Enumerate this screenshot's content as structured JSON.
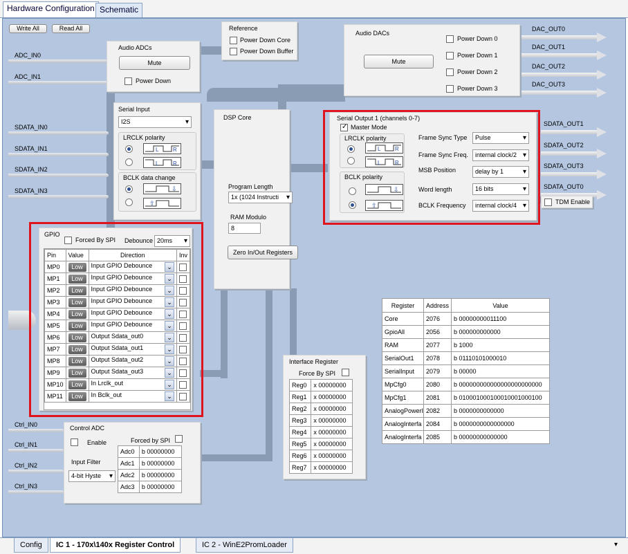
{
  "top_tabs": [
    "Hardware Configuration",
    "Schematic"
  ],
  "toolbar": {
    "write_all": "Write All",
    "read_all": "Read All"
  },
  "reference": {
    "title": "Reference",
    "power_down_core": "Power Down Core",
    "power_down_buffer": "Power Down Buffer"
  },
  "audio_adcs": {
    "title": "Audio ADCs",
    "mute": "Mute",
    "power_down": "Power Down"
  },
  "audio_dacs": {
    "title": "Audio DACs",
    "mute": "Mute",
    "pd0": "Power Down 0",
    "pd1": "Power Down 1",
    "pd2": "Power Down 2",
    "pd3": "Power Down 3"
  },
  "inputs": {
    "adc_in0": "ADC_IN0",
    "adc_in1": "ADC_IN1",
    "sdata_in0": "SDATA_IN0",
    "sdata_in1": "SDATA_IN1",
    "sdata_in2": "SDATA_IN2",
    "sdata_in3": "SDATA_IN3",
    "ctrl_in0": "Ctrl_IN0",
    "ctrl_in1": "Ctrl_IN1",
    "ctrl_in2": "Ctrl_IN2",
    "ctrl_in3": "Ctrl_IN3"
  },
  "outputs": {
    "dac0": "DAC_OUT0",
    "dac1": "DAC_OUT1",
    "dac2": "DAC_OUT2",
    "dac3": "DAC_OUT3",
    "sd1": "SDATA_OUT1",
    "sd2": "SDATA_OUT2",
    "sd3": "SDATA_OUT3",
    "sd0": "SDATA_OUT0",
    "tdm": "TDM Enable"
  },
  "serial_input": {
    "title": "Serial Input",
    "format": "I2S",
    "lrclk": "LRCLK polarity",
    "bclk": "BCLK data change"
  },
  "dsp": {
    "title": "DSP Core",
    "program_length_label": "Program Length",
    "program_length": "1x (1024 Instructi",
    "ram_modulo_label": "RAM Modulo",
    "ram_modulo": "8",
    "zero_btn": "Zero In/Out Registers"
  },
  "serial_output": {
    "title": "Serial Output 1 (channels 0-7)",
    "master": "Master Mode",
    "lrclk": "LRCLK polarity",
    "bclk": "BCLK polarity",
    "fields": [
      {
        "label": "Frame Sync Type",
        "value": "Pulse"
      },
      {
        "label": "Frame Sync Freq.",
        "value": "internal clock/2"
      },
      {
        "label": "MSB Position",
        "value": "delay by 1"
      },
      {
        "label": "Word length",
        "value": "16 bits"
      },
      {
        "label": "BCLK Frequency",
        "value": "internal clock/4"
      }
    ]
  },
  "gpio": {
    "title": "GPIO",
    "forced": "Forced By SPI",
    "debounce_label": "Debounce",
    "debounce": "20ms",
    "headers": [
      "Pin",
      "Value",
      "Direction",
      "Inv"
    ],
    "rows": [
      {
        "pin": "MP0",
        "value": "Low",
        "dir": "Input  GPIO Debounce"
      },
      {
        "pin": "MP1",
        "value": "Low",
        "dir": "Input  GPIO Debounce"
      },
      {
        "pin": "MP2",
        "value": "Low",
        "dir": "Input  GPIO Debounce"
      },
      {
        "pin": "MP3",
        "value": "Low",
        "dir": "Input  GPIO Debounce"
      },
      {
        "pin": "MP4",
        "value": "Low",
        "dir": "Input  GPIO Debounce"
      },
      {
        "pin": "MP5",
        "value": "Low",
        "dir": "Input  GPIO Debounce"
      },
      {
        "pin": "MP6",
        "value": "Low",
        "dir": "Output Sdata_out0"
      },
      {
        "pin": "MP7",
        "value": "Low",
        "dir": "Output Sdata_out1"
      },
      {
        "pin": "MP8",
        "value": "Low",
        "dir": "Output Sdata_out2"
      },
      {
        "pin": "MP9",
        "value": "Low",
        "dir": "Output Sdata_out3"
      },
      {
        "pin": "MP10",
        "value": "Low",
        "dir": "In Lrclk_out"
      },
      {
        "pin": "MP11",
        "value": "Low",
        "dir": "In Bclk_out"
      }
    ]
  },
  "control_adc": {
    "title": "Control ADC",
    "enable": "Enable",
    "forced": "Forced by SPI",
    "input_filter_label": "Input Filter",
    "input_filter": "4-bit Hyste",
    "rows": [
      {
        "name": "Adc0",
        "value": "b 00000000"
      },
      {
        "name": "Adc1",
        "value": "b 00000000"
      },
      {
        "name": "Adc2",
        "value": "b 00000000"
      },
      {
        "name": "Adc3",
        "value": "b 00000000"
      }
    ]
  },
  "interface_register": {
    "title": "Interface Register",
    "forced": "Force By SPI",
    "rows": [
      {
        "name": "Reg0",
        "value": "x 00000000"
      },
      {
        "name": "Reg1",
        "value": "x 00000000"
      },
      {
        "name": "Reg2",
        "value": "x 00000000"
      },
      {
        "name": "Reg3",
        "value": "x 00000000"
      },
      {
        "name": "Reg4",
        "value": "x 00000000"
      },
      {
        "name": "Reg5",
        "value": "x 00000000"
      },
      {
        "name": "Reg6",
        "value": "x 00000000"
      },
      {
        "name": "Reg7",
        "value": "x 00000000"
      }
    ]
  },
  "register_table": {
    "headers": [
      "Register",
      "Address",
      "Value"
    ],
    "rows": [
      {
        "name": "Core",
        "addr": "2076",
        "value": "b 00000000011100"
      },
      {
        "name": "GpioAll",
        "addr": "2056",
        "value": "b 000000000000"
      },
      {
        "name": "RAM",
        "addr": "2077",
        "value": "b 1000"
      },
      {
        "name": "SerialOut1",
        "addr": "2078",
        "value": "b 01110101000010"
      },
      {
        "name": "SerialInput",
        "addr": "2079",
        "value": "b 00000"
      },
      {
        "name": "MpCfg0",
        "addr": "2080",
        "value": "b 000000000000000000000000"
      },
      {
        "name": "MpCfg1",
        "addr": "2081",
        "value": "b 010001000100010001000100"
      },
      {
        "name": "AnalogPowerI",
        "addr": "2082",
        "value": "b 0000000000000"
      },
      {
        "name": "AnalogInterfa",
        "addr": "2084",
        "value": "b 0000000000000000"
      },
      {
        "name": "AnalogInterfa",
        "addr": "2085",
        "value": "b 00000000000000"
      }
    ]
  },
  "bottom_tabs": [
    "Config",
    "IC 1 - 170x\\140x Register Control",
    "IC 2 - WinE2PromLoader"
  ],
  "colors": {
    "canvas": "#b4c6e0",
    "highlight": "#e0141e",
    "pipe": "#8a9cb3"
  }
}
